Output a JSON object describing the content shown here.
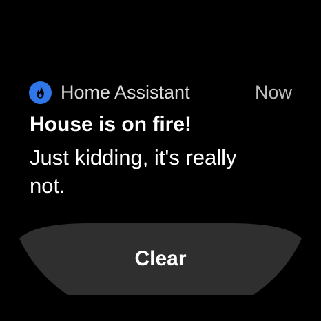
{
  "notification": {
    "app_icon": "fire-icon",
    "app_name": "Home Assistant",
    "time": "Now",
    "title": "House is on fire!",
    "body": "Just kidding, it's really not."
  },
  "actions": {
    "clear_label": "Clear"
  },
  "colors": {
    "background": "#000000",
    "icon_accent": "#2f77e8",
    "button_surface": "#2f2f2f"
  }
}
